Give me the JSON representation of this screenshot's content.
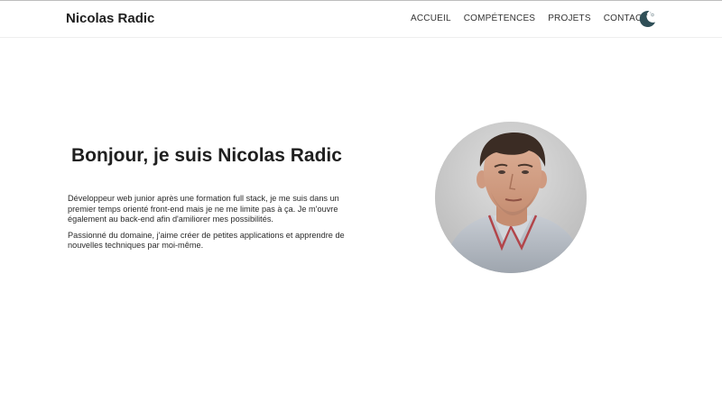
{
  "header": {
    "brand": "Nicolas Radic",
    "nav": [
      {
        "label": "ACCUEIL"
      },
      {
        "label": "COMPÉTENCES"
      },
      {
        "label": "PROJETS"
      },
      {
        "label": "CONTACT"
      }
    ],
    "theme_toggle_icon": "moon-icon"
  },
  "hero": {
    "title": "Bonjour, je suis Nicolas Radic",
    "paragraph1": "Développeur web junior après une formation full stack, je me suis dans un premier temps orienté front-end mais je ne me limite pas à ça. Je m'ouvre également au back-end afin d'amiliorer mes possibilités.",
    "paragraph2": "Passionné du domaine, j'aime créer de petites applications et apprendre de nouvelles techniques par moi-même.",
    "avatar_icon": "portrait-photo"
  },
  "colors": {
    "text": "#222222",
    "background": "#ffffff",
    "toggle": "#2f4f57"
  }
}
